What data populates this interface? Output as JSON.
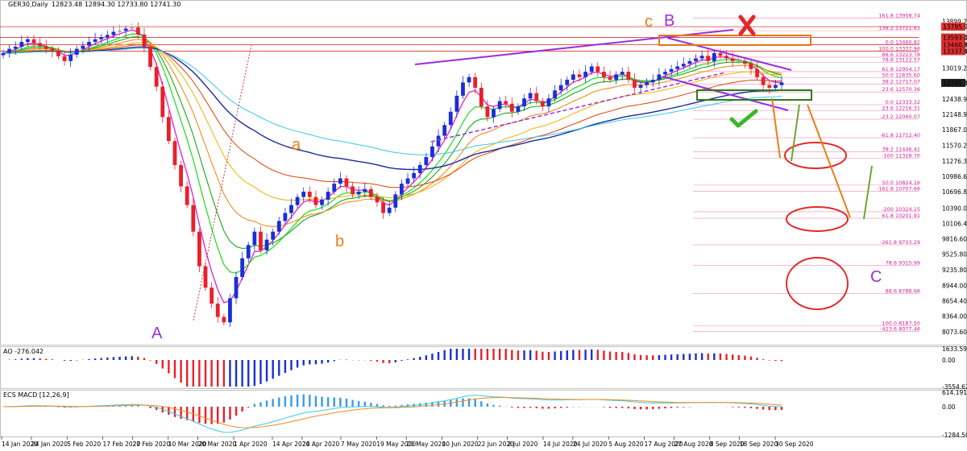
{
  "header": {
    "symbol": "GER30,Daily",
    "ohlc": "12823.48 12894.30 12733.80 12741.30"
  },
  "colors": {
    "bull": "#1a2fd6",
    "bear": "#e8202a",
    "neutral": "#9a9a9a",
    "ema_fast": "#e020c8",
    "ema_green1": "#2adf2a",
    "ema_green2": "#18a818",
    "ema_orange": "#f08c1e",
    "ema_red": "#e0501a",
    "ema_navy": "#1a2a9a",
    "ema_cyan": "#3ac8e8",
    "ema_yellow": "#f0b000",
    "wave_orange": "#e87e16",
    "wave_purple": "#9a2ee0",
    "fib_line": "#f0a0c0",
    "fib_text": "#d0209a",
    "hline": "#e03030"
  },
  "chart_data": [
    {
      "type": "candlestick",
      "title": "GER30,Daily",
      "ylim": [
        7860,
        14100
      ],
      "price_ticks": [
        "13899.20",
        "13593.07",
        "13460.81",
        "13337.96",
        "13019.20",
        "12741.30",
        "12438.90",
        "12148.90",
        "11867.00",
        "11570.20",
        "11276.30",
        "10986.60",
        "10696.80",
        "10390.00",
        "10106.40",
        "9816.60",
        "9525.80",
        "9235.80",
        "8944.00",
        "8654.40",
        "8364.00",
        "8073.60"
      ],
      "price_ticks_values": [
        13899.2,
        13593.07,
        13460.81,
        13337.96,
        13019.2,
        12741.3,
        12438.9,
        12148.9,
        11867.0,
        11570.2,
        11276.3,
        10986.6,
        10696.8,
        10390.0,
        10106.4,
        9816.6,
        9525.8,
        9235.8,
        8944.0,
        8654.4,
        8364.0,
        8073.6
      ],
      "tags": [
        {
          "label": "13795.96",
          "value": 13795.96,
          "color": "#e03030"
        },
        {
          "label": "13593.07",
          "value": 13593.07,
          "color": "#e03030"
        },
        {
          "label": "13460.81",
          "value": 13460.81,
          "color": "#e03030"
        },
        {
          "label": "13337.96",
          "value": 13337.96,
          "color": "#e03030"
        },
        {
          "label": "12741.30",
          "value": 12741.3,
          "color": "#202020"
        }
      ],
      "horizontal_lines": [
        13795.96,
        13593.07,
        13460.81,
        13337.96
      ],
      "date_labels": [
        "14 Jan 2020",
        "24 Jan 2020",
        "5 Feb 2020",
        "17 Feb 2020",
        "27 Feb 2020",
        "10 Mar 2020",
        "20 Mar 2020",
        "1 Apr 2020",
        "14 Apr 2020",
        "24 Apr 2020",
        "7 May 2020",
        "19 May 2020",
        "29 May 2020",
        "10 Jun 2020",
        "22 Jun 2020",
        "2 Jul 2020",
        "14 Jul 2020",
        "24 Jul 2020",
        "5 Aug 2020",
        "17 Aug 2020",
        "27 Aug 2020",
        "8 Sep 2020",
        "18 Sep 2020",
        "30 Sep 2020"
      ],
      "date_values": [
        "2020-01-14",
        "2020-01-24",
        "2020-02-05",
        "2020-02-17",
        "2020-02-27",
        "2020-03-10",
        "2020-03-20",
        "2020-04-01",
        "2020-04-14",
        "2020-04-24",
        "2020-05-07",
        "2020-05-19",
        "2020-05-29",
        "2020-06-10",
        "2020-06-22",
        "2020-07-02",
        "2020-07-14",
        "2020-07-24",
        "2020-08-05",
        "2020-08-17",
        "2020-08-27",
        "2020-09-08",
        "2020-09-18",
        "2020-09-30"
      ],
      "closes": [
        13300,
        13380,
        13420,
        13510,
        13560,
        13490,
        13430,
        13380,
        13330,
        13240,
        13150,
        13270,
        13380,
        13440,
        13510,
        13560,
        13600,
        13640,
        13700,
        13720,
        13760,
        13780,
        13650,
        13420,
        13040,
        12670,
        12100,
        11650,
        11200,
        10800,
        10450,
        9950,
        9300,
        8900,
        8600,
        8350,
        8250,
        8700,
        9100,
        9450,
        9700,
        9950,
        9600,
        9800,
        9950,
        10150,
        10300,
        10450,
        10600,
        10700,
        10600,
        10450,
        10550,
        10700,
        10850,
        10950,
        10800,
        10650,
        10700,
        10750,
        10600,
        10500,
        10300,
        10400,
        10650,
        10850,
        10950,
        11050,
        11200,
        11350,
        11550,
        11750,
        11950,
        12200,
        12500,
        12750,
        12850,
        12650,
        12300,
        12100,
        12250,
        12400,
        12350,
        12200,
        12300,
        12450,
        12550,
        12400,
        12300,
        12450,
        12600,
        12700,
        12800,
        12900,
        12850,
        12950,
        13050,
        12950,
        12850,
        12800,
        12900,
        12950,
        12800,
        12650,
        12700,
        12750,
        12800,
        12900,
        12950,
        13000,
        13050,
        13100,
        13150,
        13200,
        13250,
        13150,
        13300,
        13250,
        13200,
        13150,
        13150,
        13100,
        13000,
        12850,
        12700,
        12650,
        12700,
        12750
      ],
      "labels": [
        "A",
        "a",
        "b",
        "c",
        "B",
        "C"
      ],
      "fib_levels": [
        {
          "label": "161.8  13958.74",
          "value": 13958.74
        },
        {
          "label": "138.2  13721.63",
          "value": 13721.63
        },
        {
          "label": "0.0  13460.81",
          "value": 13460.81
        },
        {
          "label": "100.0  13337.96",
          "value": 13337.96
        },
        {
          "label": "88.6  13223.78",
          "value": 13223.78
        },
        {
          "label": "78.6  13122.57",
          "value": 13122.57
        },
        {
          "label": "61.8  12954.17",
          "value": 12954.17
        },
        {
          "label": "50.0  12835.60",
          "value": 12835.6
        },
        {
          "label": "38.2  12717.07",
          "value": 12717.07
        },
        {
          "label": "23.6  12570.36",
          "value": 12570.36
        },
        {
          "label": "0.0  12333.32",
          "value": 12333.32
        },
        {
          "label": "23.6  12216.31",
          "value": 12216.31
        },
        {
          "label": "-23.2  12060.07",
          "value": 12060.07
        },
        {
          "label": "-61.8  11712.40",
          "value": 11712.4
        },
        {
          "label": "38.2  11446.41",
          "value": 11446.41
        },
        {
          "label": "-100  11328.70",
          "value": 11328.7
        },
        {
          "label": "50.0  10824.16",
          "value": 10824.16
        },
        {
          "label": "-161.8  10707.66",
          "value": 10707.66
        },
        {
          "label": "-200  10324.15",
          "value": 10324.15
        },
        {
          "label": "61.8  10201.91",
          "value": 10201.91
        },
        {
          "label": "-261.8  9703.29",
          "value": 9703.29
        },
        {
          "label": "78.6  9315.99",
          "value": 9315.99
        },
        {
          "label": "88.6  8788.66",
          "value": 8788.66
        },
        {
          "label": "100.0  8187.50",
          "value": 8187.5
        },
        {
          "label": "-423.6  8077.46",
          "value": 8077.46
        }
      ]
    },
    {
      "type": "bar",
      "title": "AO -276.042",
      "ticks": [
        "1633.593",
        "0.00",
        "-3554.626"
      ],
      "ticks_values": [
        1633.593,
        0,
        -3554.626
      ],
      "ylim": [
        -3554.626,
        1633.593
      ]
    },
    {
      "type": "bar",
      "title": "ECS MACD [12,26,9]",
      "ticks": [
        "614.1911",
        "0.00",
        "-1284.5035"
      ],
      "ticks_values": [
        614.1911,
        0,
        -1284.5035
      ],
      "ylim": [
        -1284.5035,
        614.1911
      ]
    }
  ]
}
